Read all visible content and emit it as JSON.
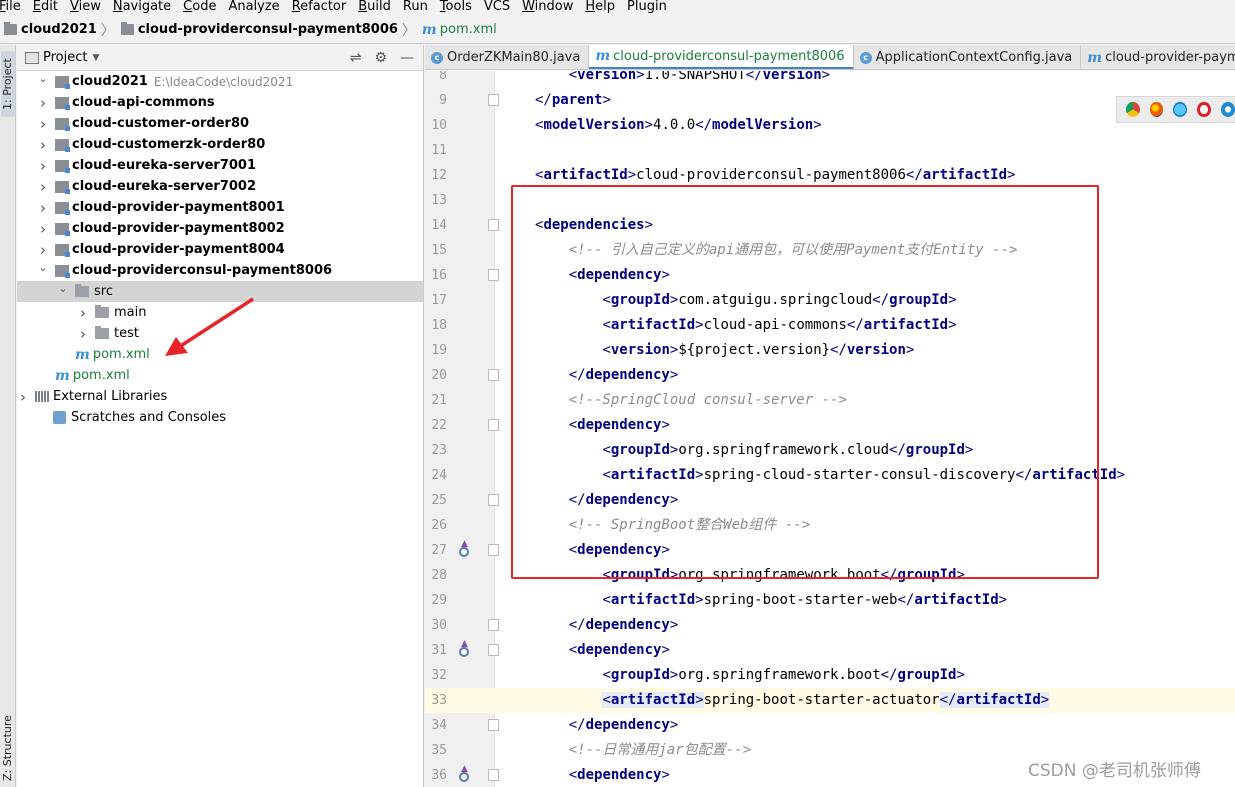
{
  "menubar": {
    "items": [
      {
        "label": "File",
        "mnemonic": "F",
        "rest": "ile"
      },
      {
        "label": "Edit",
        "mnemonic": "E",
        "rest": "dit"
      },
      {
        "label": "View",
        "mnemonic": "V",
        "rest": "iew"
      },
      {
        "label": "Navigate",
        "mnemonic": "N",
        "rest": "avigate"
      },
      {
        "label": "Code",
        "mnemonic": "C",
        "rest": "ode"
      },
      {
        "label": "Analyze",
        "mnemonic": "",
        "rest": "Analyze"
      },
      {
        "label": "Refactor",
        "mnemonic": "R",
        "rest": "efactor"
      },
      {
        "label": "Build",
        "mnemonic": "B",
        "rest": "uild"
      },
      {
        "label": "Run",
        "mnemonic": "",
        "rest": "Run"
      },
      {
        "label": "Tools",
        "mnemonic": "T",
        "rest": "ools"
      },
      {
        "label": "VCS",
        "mnemonic": "",
        "rest": "VCS"
      },
      {
        "label": "Window",
        "mnemonic": "W",
        "rest": "indow"
      },
      {
        "label": "Help",
        "mnemonic": "H",
        "rest": "elp"
      },
      {
        "label": "Plugin",
        "mnemonic": "",
        "rest": "Plugin"
      }
    ]
  },
  "breadcrumb": {
    "project": "cloud2021",
    "module": "cloud-providerconsul-payment8006",
    "file": "pom.xml"
  },
  "tool_windows": {
    "project_tab": "1: Project",
    "structure_tab": "Z: Structure"
  },
  "project_panel": {
    "title": "Project",
    "root": {
      "name": "cloud2021",
      "path": "E:\\IdeaCode\\cloud2021"
    },
    "modules": [
      "cloud-api-commons",
      "cloud-customer-order80",
      "cloud-customerzk-order80",
      "cloud-eureka-server7001",
      "cloud-eureka-server7002",
      "cloud-provider-payment8001",
      "cloud-provider-payment8002",
      "cloud-provider-payment8004",
      "cloud-providerconsul-payment8006"
    ],
    "src": "src",
    "main": "main",
    "test": "test",
    "module_pom": "pom.xml",
    "root_pom": "pom.xml",
    "external_libraries": "External Libraries",
    "scratches": "Scratches and Consoles"
  },
  "editor_tabs": [
    {
      "label": "OrderZKMain80.java",
      "icon": "class-icon"
    },
    {
      "label": "cloud-providerconsul-payment8006",
      "icon": "maven-icon",
      "active": true
    },
    {
      "label": "ApplicationContextConfig.java",
      "icon": "class-icon"
    },
    {
      "label": "cloud-provider-payment",
      "icon": "maven-icon"
    }
  ],
  "editor": {
    "current_line": 33,
    "lines": [
      {
        "n": "8",
        "text": "    <version>1.0-SNAPSHOT</version>"
      },
      {
        "n": "9",
        "text": "</parent>"
      },
      {
        "n": "10",
        "text": "<modelVersion>4.0.0</modelVersion>"
      },
      {
        "n": "11",
        "text": ""
      },
      {
        "n": "12",
        "text": "<artifactId>cloud-providerconsul-payment8006</artifactId>"
      },
      {
        "n": "13",
        "text": ""
      },
      {
        "n": "14",
        "text": "<dependencies>"
      },
      {
        "n": "15",
        "text": "    <!-- 引入自己定义的api通用包，可以使用Payment支付Entity -->"
      },
      {
        "n": "16",
        "text": "    <dependency>"
      },
      {
        "n": "17",
        "text": "        <groupId>com.atguigu.springcloud</groupId>"
      },
      {
        "n": "18",
        "text": "        <artifactId>cloud-api-commons</artifactId>"
      },
      {
        "n": "19",
        "text": "        <version>${project.version}</version>"
      },
      {
        "n": "20",
        "text": "    </dependency>"
      },
      {
        "n": "21",
        "text": "    <!--SpringCloud consul-server -->"
      },
      {
        "n": "22",
        "text": "    <dependency>"
      },
      {
        "n": "23",
        "text": "        <groupId>org.springframework.cloud</groupId>"
      },
      {
        "n": "24",
        "text": "        <artifactId>spring-cloud-starter-consul-discovery</artifactId>"
      },
      {
        "n": "25",
        "text": "    </dependency>"
      },
      {
        "n": "26",
        "text": "    <!-- SpringBoot整合Web组件 -->"
      },
      {
        "n": "27",
        "text": "    <dependency>"
      },
      {
        "n": "28",
        "text": "        <groupId>org.springframework.boot</groupId>"
      },
      {
        "n": "29",
        "text": "        <artifactId>spring-boot-starter-web</artifactId>"
      },
      {
        "n": "30",
        "text": "    </dependency>"
      },
      {
        "n": "31",
        "text": "    <dependency>"
      },
      {
        "n": "32",
        "text": "        <groupId>org.springframework.boot</groupId>"
      },
      {
        "n": "33",
        "text": "        <artifactId>spring-boot-starter-actuator</artifactId>"
      },
      {
        "n": "34",
        "text": "    </dependency>"
      },
      {
        "n": "35",
        "text": "    <!--日常通用jar包配置-->"
      },
      {
        "n": "36",
        "text": "    <dependency>"
      }
    ]
  },
  "watermark": "CSDN @老司机张师傅",
  "colors": {
    "annotation_red": "#e8232a",
    "tag_blue": "#000080",
    "comment_gray": "#8c8c8c",
    "maven_green": "#1c7d3c"
  }
}
